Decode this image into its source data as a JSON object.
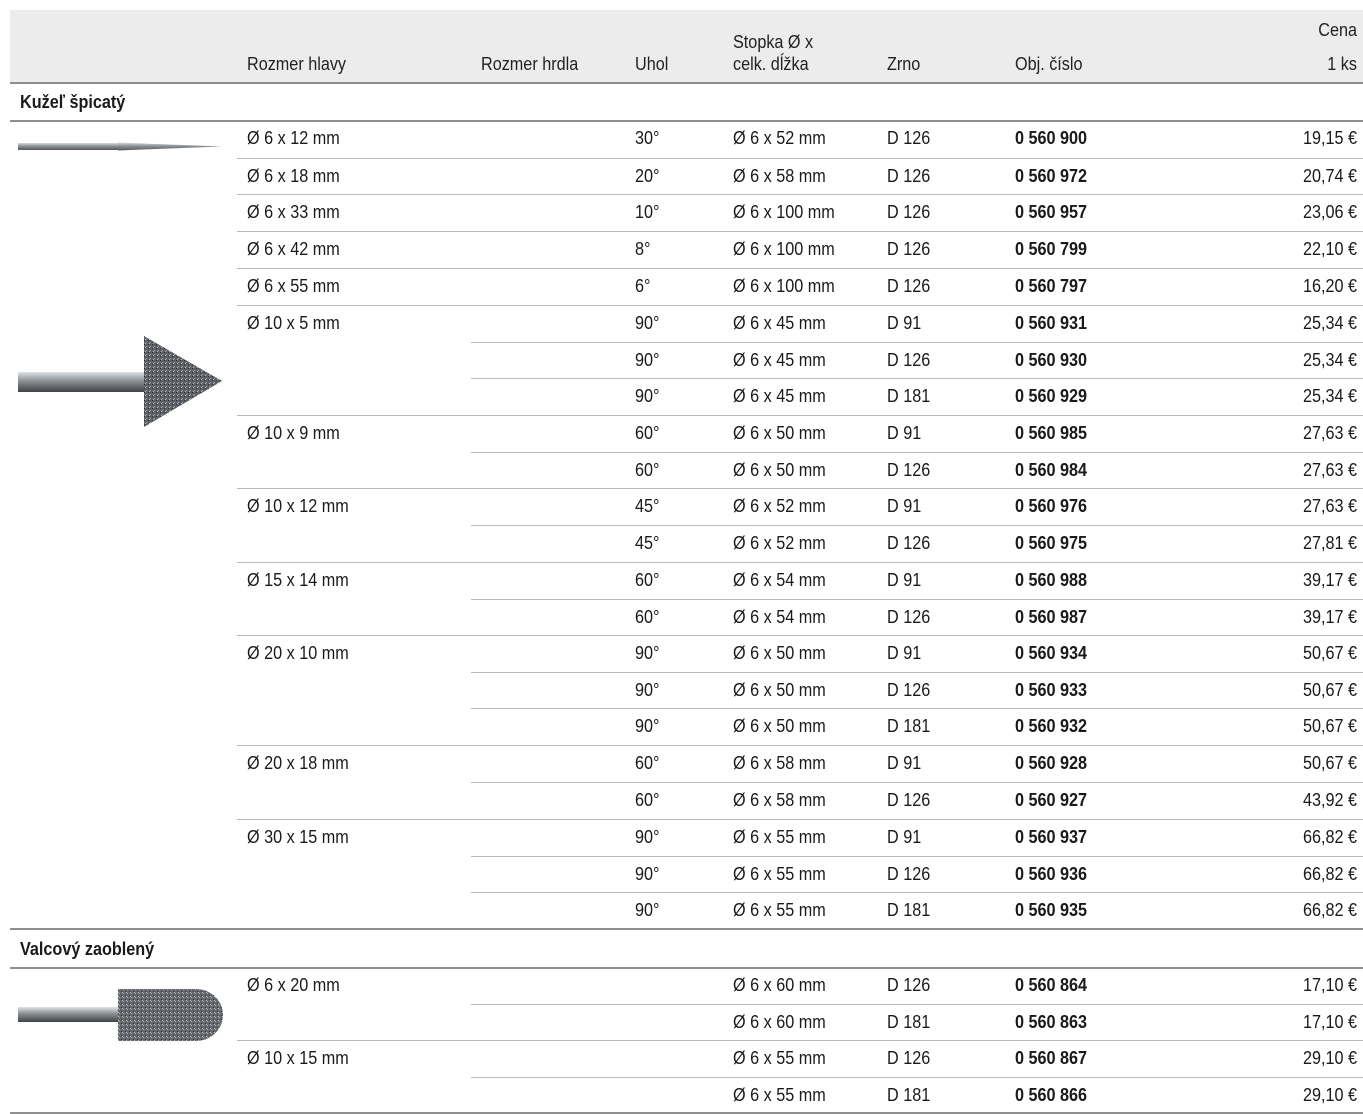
{
  "header": {
    "head": "Rozmer hlavy",
    "neck": "Rozmer hrdla",
    "angle": "Uhol",
    "shank_line1": "Stopka Ø x",
    "shank_line2": "celk. dĺžka",
    "grit": "Zrno",
    "order": "Obj. číslo",
    "price_line1": "Cena",
    "price_line2": "1 ks"
  },
  "sections": [
    {
      "title": "Kužeľ špicatý",
      "rows": [
        {
          "head": "Ø 6 x 12 mm",
          "angle": "30°",
          "shank": "Ø 6 x 52 mm",
          "grit": "D 126",
          "order": "0 560 900",
          "price": "19,15 €"
        },
        {
          "head": "Ø 6 x 18 mm",
          "angle": "20°",
          "shank": "Ø 6 x 58 mm",
          "grit": "D 126",
          "order": "0 560 972",
          "price": "20,74 €"
        },
        {
          "head": "Ø 6 x 33 mm",
          "angle": "10°",
          "shank": "Ø 6 x 100 mm",
          "grit": "D 126",
          "order": "0 560 957",
          "price": "23,06 €"
        },
        {
          "head": "Ø 6 x 42 mm",
          "angle": "8°",
          "shank": "Ø 6 x 100 mm",
          "grit": "D 126",
          "order": "0 560 799",
          "price": "22,10 €"
        },
        {
          "head": "Ø 6 x 55 mm",
          "angle": "6°",
          "shank": "Ø 6 x 100 mm",
          "grit": "D 126",
          "order": "0 560 797",
          "price": "16,20 €"
        },
        {
          "head": "Ø 10 x 5 mm",
          "angle": "90°",
          "shank": "Ø 6 x 45 mm",
          "grit": "D 91",
          "order": "0 560 931",
          "price": "25,34 €"
        },
        {
          "head": "",
          "angle": "90°",
          "shank": "Ø 6 x 45 mm",
          "grit": "D 126",
          "order": "0 560 930",
          "price": "25,34 €"
        },
        {
          "head": "",
          "angle": "90°",
          "shank": "Ø 6 x 45 mm",
          "grit": "D 181",
          "order": "0 560 929",
          "price": "25,34 €"
        },
        {
          "head": "Ø 10 x 9 mm",
          "angle": "60°",
          "shank": "Ø 6 x 50 mm",
          "grit": "D 91",
          "order": "0 560 985",
          "price": "27,63 €"
        },
        {
          "head": "",
          "angle": "60°",
          "shank": "Ø 6 x 50 mm",
          "grit": "D 126",
          "order": "0 560 984",
          "price": "27,63 €"
        },
        {
          "head": "Ø 10 x 12 mm",
          "angle": "45°",
          "shank": "Ø 6 x 52 mm",
          "grit": "D 91",
          "order": "0 560 976",
          "price": "27,63 €"
        },
        {
          "head": "",
          "angle": "45°",
          "shank": "Ø 6 x 52 mm",
          "grit": "D 126",
          "order": "0 560 975",
          "price": "27,81 €"
        },
        {
          "head": "Ø 15 x 14 mm",
          "angle": "60°",
          "shank": "Ø 6 x 54 mm",
          "grit": "D 91",
          "order": "0 560 988",
          "price": "39,17 €"
        },
        {
          "head": "",
          "angle": "60°",
          "shank": "Ø 6 x 54 mm",
          "grit": "D 126",
          "order": "0 560 987",
          "price": "39,17 €"
        },
        {
          "head": "Ø 20 x 10 mm",
          "angle": "90°",
          "shank": "Ø 6 x 50 mm",
          "grit": "D 91",
          "order": "0 560 934",
          "price": "50,67 €"
        },
        {
          "head": "",
          "angle": "90°",
          "shank": "Ø 6 x 50 mm",
          "grit": "D 126",
          "order": "0 560 933",
          "price": "50,67 €"
        },
        {
          "head": "",
          "angle": "90°",
          "shank": "Ø 6 x 50 mm",
          "grit": "D 181",
          "order": "0 560 932",
          "price": "50,67 €"
        },
        {
          "head": "Ø 20 x 18 mm",
          "angle": "60°",
          "shank": "Ø 6 x 58 mm",
          "grit": "D 91",
          "order": "0 560 928",
          "price": "50,67 €"
        },
        {
          "head": "",
          "angle": "60°",
          "shank": "Ø 6 x 58 mm",
          "grit": "D 126",
          "order": "0 560 927",
          "price": "43,92 €"
        },
        {
          "head": "Ø 30 x 15 mm",
          "angle": "90°",
          "shank": "Ø 6 x 55 mm",
          "grit": "D 91",
          "order": "0 560 937",
          "price": "66,82 €"
        },
        {
          "head": "",
          "angle": "90°",
          "shank": "Ø 6 x 55 mm",
          "grit": "D 126",
          "order": "0 560 936",
          "price": "66,82 €"
        },
        {
          "head": "",
          "angle": "90°",
          "shank": "Ø 6 x 55 mm",
          "grit": "D 181",
          "order": "0 560 935",
          "price": "66,82 €"
        }
      ]
    },
    {
      "title": "Valcový zaoblený",
      "rows": [
        {
          "head": "Ø 6 x 20 mm",
          "angle": "",
          "shank": "Ø 6 x 60 mm",
          "grit": "D 126",
          "order": "0 560 864",
          "price": "17,10 €"
        },
        {
          "head": "",
          "angle": "",
          "shank": "Ø 6 x 60 mm",
          "grit": "D 181",
          "order": "0 560 863",
          "price": "17,10 €"
        },
        {
          "head": "Ø 10 x 15 mm",
          "angle": "",
          "shank": "Ø 6 x 55 mm",
          "grit": "D 126",
          "order": "0 560 867",
          "price": "29,10 €"
        },
        {
          "head": "",
          "angle": "",
          "shank": "Ø 6 x 55 mm",
          "grit": "D 181",
          "order": "0 560 866",
          "price": "29,10 €"
        }
      ]
    }
  ],
  "icons": [
    "pointed-cone-thin-tool-icon",
    "pointed-cone-tool-icon",
    "rounded-cylinder-tool-icon"
  ]
}
